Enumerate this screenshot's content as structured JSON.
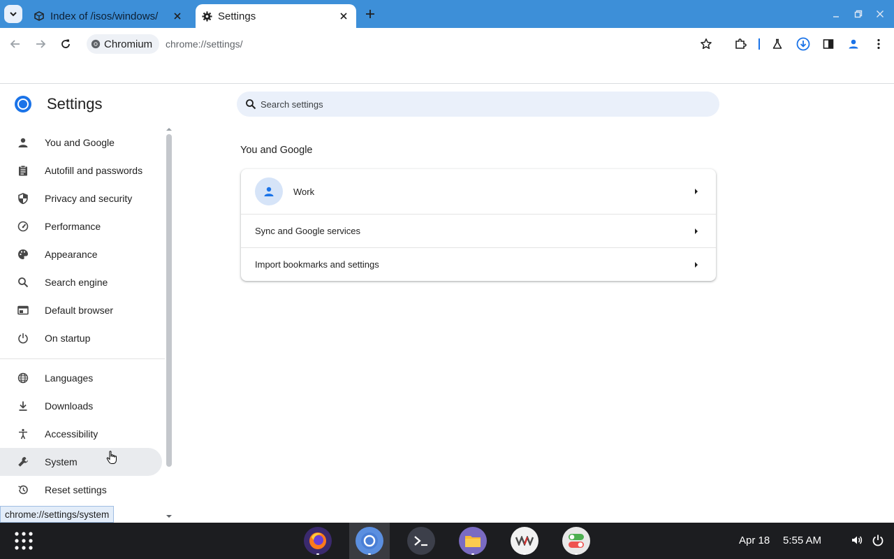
{
  "browser": {
    "tabs": [
      {
        "title": "Index of /isos/windows/",
        "icon": "folder-cloud-icon",
        "active": false
      },
      {
        "title": "Settings",
        "icon": "gear-icon",
        "active": true
      }
    ],
    "omnibox": {
      "chip_label": "Chromium",
      "url": "chrome://settings/"
    },
    "status_link": "chrome://settings/system"
  },
  "settings": {
    "title": "Settings",
    "search_placeholder": "Search settings",
    "nav": [
      {
        "label": "You and Google",
        "icon": "person-icon"
      },
      {
        "label": "Autofill and passwords",
        "icon": "clipboard-icon"
      },
      {
        "label": "Privacy and security",
        "icon": "shield-icon"
      },
      {
        "label": "Performance",
        "icon": "speedometer-icon"
      },
      {
        "label": "Appearance",
        "icon": "palette-icon"
      },
      {
        "label": "Search engine",
        "icon": "search-icon"
      },
      {
        "label": "Default browser",
        "icon": "browser-window-icon"
      },
      {
        "label": "On startup",
        "icon": "power-icon"
      },
      {
        "label": "Languages",
        "icon": "globe-icon"
      },
      {
        "label": "Downloads",
        "icon": "download-icon"
      },
      {
        "label": "Accessibility",
        "icon": "accessibility-icon"
      },
      {
        "label": "System",
        "icon": "wrench-icon",
        "hovered": true
      },
      {
        "label": "Reset settings",
        "icon": "history-icon"
      }
    ],
    "section_title": "You and Google",
    "rows": [
      {
        "label": "Work",
        "icon": "person-icon"
      },
      {
        "label": "Sync and Google services"
      },
      {
        "label": "Import bookmarks and settings"
      }
    ]
  },
  "taskbar": {
    "apps": [
      "firefox-icon",
      "chromium-icon",
      "terminal-icon",
      "files-icon",
      "vm-icon",
      "toggle-settings-icon"
    ],
    "date": "Apr 18",
    "time": "5:55 AM"
  },
  "colors": {
    "tabstrip": "#3d8fd8",
    "accent": "#1a73e8",
    "search_bg": "#eaf0fa",
    "taskbar": "#1c1d20"
  }
}
